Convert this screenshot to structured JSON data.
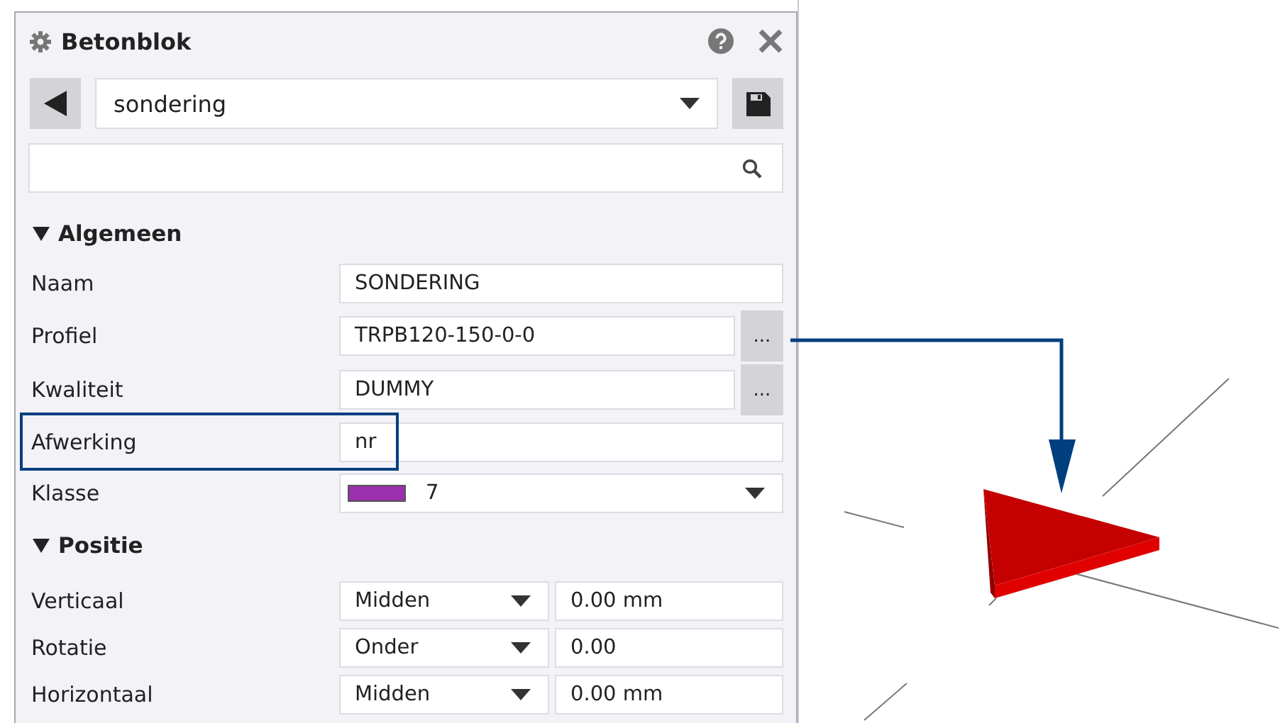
{
  "panel": {
    "title": "Betonblok",
    "preset": {
      "value": "sondering"
    },
    "sections": [
      {
        "title": "Algemeen",
        "expanded": true,
        "rows": [
          {
            "kind": "text",
            "label": "Naam",
            "value": "SONDERING",
            "highlighted": false
          },
          {
            "kind": "browse",
            "label": "Profiel",
            "value": "TRPB120-150-0-0",
            "button": "...",
            "highlighted": false
          },
          {
            "kind": "browse",
            "label": "Kwaliteit",
            "value": "DUMMY",
            "button": "...",
            "highlighted": false
          },
          {
            "kind": "text",
            "label": "Afwerking",
            "value": "nr",
            "highlighted": true
          },
          {
            "kind": "color-select",
            "label": "Klasse",
            "value": "7",
            "color": "#9b2fae",
            "highlighted": false
          }
        ]
      },
      {
        "title": "Positie",
        "expanded": true,
        "rows": [
          {
            "kind": "select-value",
            "label": "Verticaal",
            "select": "Midden",
            "value": "0.00 mm",
            "highlighted": false
          },
          {
            "kind": "select-value",
            "label": "Rotatie",
            "select": "Onder",
            "value": "0.00",
            "highlighted": false
          },
          {
            "kind": "select-value",
            "label": "Horizontaal",
            "select": "Midden",
            "value": "0.00 mm",
            "highlighted": false
          }
        ]
      }
    ]
  }
}
